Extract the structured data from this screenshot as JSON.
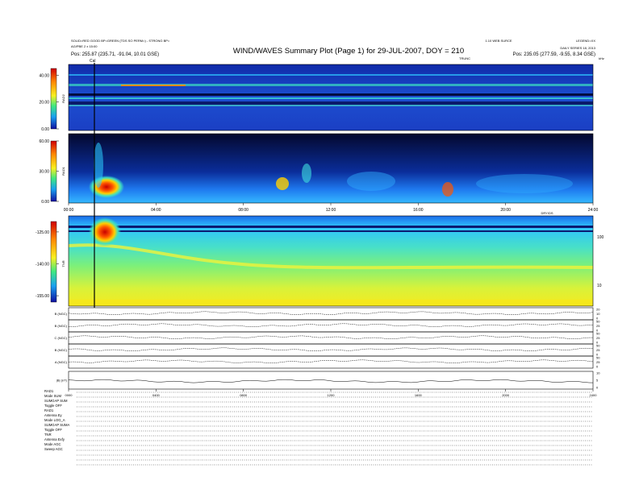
{
  "header": {
    "title": "WIND/WAVES Summary Plot (Page 1) for 29-JUL-2007, DOY = 210",
    "left_line1": "SOLID=RED  GOOD BP=GREEN  (TDS SO PERM=) - STRONG BP=",
    "left_line2": "AG/PBE 2 x 15:00",
    "left_line3": "Pos:  255.87 (235.71, -91.04, 10.01 GSE)",
    "right_line1": "LEGEND=XX",
    "right_line2": "DAILY SERIES 18, 2013",
    "right_line3": "Pos:  235.05 (277.59, -9.55, 8.34 GSE)",
    "center_small": "1.10 WEB SURCE",
    "mid_label": "TRUNC",
    "right_unit": "kHz",
    "flag_label": "Cal"
  },
  "chart_data": [
    {
      "type": "heatmap",
      "name": "RAD2",
      "ylabel": "RAD2",
      "ytick_labels": [
        "40.00",
        "20.00",
        "0.00"
      ],
      "yticks": [
        40,
        20,
        0
      ],
      "ylim": [
        0,
        45
      ],
      "colors": {
        "low": "#0a1fa8",
        "mid": "#29c4ff",
        "high": "#ff2a00"
      }
    },
    {
      "type": "heatmap",
      "name": "RAD1",
      "ylabel": "RAD1",
      "ytick_labels": [
        "60.00",
        "30.00",
        "0.00"
      ],
      "yticks": [
        60,
        30,
        0
      ],
      "ylim": [
        0,
        60
      ],
      "x_tick_labels": [
        "00:00",
        "04:00",
        "08:00",
        "12:00",
        "16:00",
        "20:00",
        "24:00"
      ],
      "x_hours": [
        0,
        4,
        8,
        12,
        16,
        20,
        24
      ]
    },
    {
      "type": "heatmap",
      "name": "TNR",
      "ylabel": "TNR",
      "ytick_labels": [
        "-125.00",
        "-140.00",
        "-155.00"
      ],
      "yticks": [
        -125,
        -140,
        -155
      ],
      "ylim": [
        -158,
        -122
      ],
      "right_tick_labels": [
        "100",
        "10"
      ],
      "corner_label": "DRY/DS"
    },
    {
      "type": "line",
      "name": "Magnetic field panels",
      "panels": [
        {
          "label": "B (NGC)",
          "right_ticks": [
            "20",
            "10",
            "0"
          ]
        },
        {
          "label": "B (NGC)",
          "right_ticks": [
            "50",
            "25",
            "0"
          ]
        },
        {
          "label": "C (NGC)",
          "right_ticks": [
            "50",
            "25",
            "0"
          ]
        },
        {
          "label": "B (NGC)",
          "right_ticks": [
            "50",
            "25",
            "0"
          ]
        },
        {
          "label": "A (NGC)",
          "right_ticks": [
            "50",
            "25",
            "0"
          ]
        },
        {
          "label": "|B| (nT)",
          "right_ticks": [
            "10",
            "5",
            "0"
          ]
        }
      ],
      "x_tick_labels": [
        "0000",
        "0400",
        "0800",
        "1200",
        "1600",
        "2000",
        "2400"
      ],
      "x_hours": [
        0,
        4,
        8,
        12,
        16,
        20,
        24
      ]
    }
  ],
  "info_block": {
    "lines": [
      "RAD1",
      "Mode   SUM",
      "SUMGAP SUM",
      "Toggle  OFF",
      "RAD1",
      "Antenna  Ey",
      "Mode   LOG_A",
      "SUMGAP SUMA",
      "Toggle  OFF",
      "TNR",
      "Antenna  Exfy",
      "Mode   AGC",
      "Sweep   AGC"
    ]
  }
}
